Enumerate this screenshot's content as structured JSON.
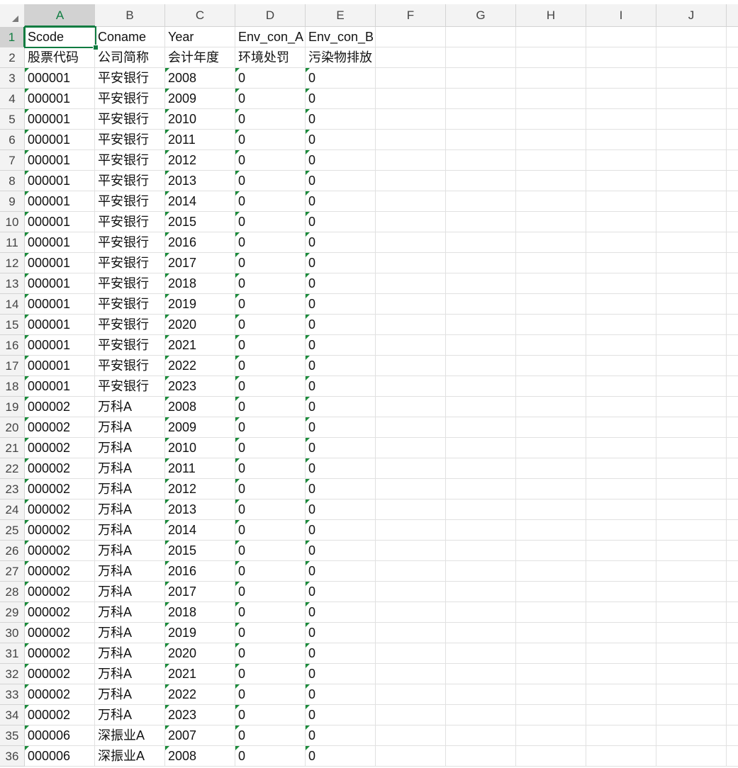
{
  "columns": [
    "A",
    "B",
    "C",
    "D",
    "E",
    "F",
    "G",
    "H",
    "I",
    "J"
  ],
  "selected_cell": "A1",
  "accent_color": "#107c41",
  "rows": [
    [
      "Scode",
      "Coname",
      "Year",
      "Env_con_A",
      "Env_con_B"
    ],
    [
      "股票代码",
      "公司简称",
      "会计年度",
      "环境处罚",
      "污染物排放"
    ],
    [
      "000001",
      "平安银行",
      "2008",
      "0",
      "0"
    ],
    [
      "000001",
      "平安银行",
      "2009",
      "0",
      "0"
    ],
    [
      "000001",
      "平安银行",
      "2010",
      "0",
      "0"
    ],
    [
      "000001",
      "平安银行",
      "2011",
      "0",
      "0"
    ],
    [
      "000001",
      "平安银行",
      "2012",
      "0",
      "0"
    ],
    [
      "000001",
      "平安银行",
      "2013",
      "0",
      "0"
    ],
    [
      "000001",
      "平安银行",
      "2014",
      "0",
      "0"
    ],
    [
      "000001",
      "平安银行",
      "2015",
      "0",
      "0"
    ],
    [
      "000001",
      "平安银行",
      "2016",
      "0",
      "0"
    ],
    [
      "000001",
      "平安银行",
      "2017",
      "0",
      "0"
    ],
    [
      "000001",
      "平安银行",
      "2018",
      "0",
      "0"
    ],
    [
      "000001",
      "平安银行",
      "2019",
      "0",
      "0"
    ],
    [
      "000001",
      "平安银行",
      "2020",
      "0",
      "0"
    ],
    [
      "000001",
      "平安银行",
      "2021",
      "0",
      "0"
    ],
    [
      "000001",
      "平安银行",
      "2022",
      "0",
      "0"
    ],
    [
      "000001",
      "平安银行",
      "2023",
      "0",
      "0"
    ],
    [
      "000002",
      "万科A",
      "2008",
      "0",
      "0"
    ],
    [
      "000002",
      "万科A",
      "2009",
      "0",
      "0"
    ],
    [
      "000002",
      "万科A",
      "2010",
      "0",
      "0"
    ],
    [
      "000002",
      "万科A",
      "2011",
      "0",
      "0"
    ],
    [
      "000002",
      "万科A",
      "2012",
      "0",
      "0"
    ],
    [
      "000002",
      "万科A",
      "2013",
      "0",
      "0"
    ],
    [
      "000002",
      "万科A",
      "2014",
      "0",
      "0"
    ],
    [
      "000002",
      "万科A",
      "2015",
      "0",
      "0"
    ],
    [
      "000002",
      "万科A",
      "2016",
      "0",
      "0"
    ],
    [
      "000002",
      "万科A",
      "2017",
      "0",
      "0"
    ],
    [
      "000002",
      "万科A",
      "2018",
      "0",
      "0"
    ],
    [
      "000002",
      "万科A",
      "2019",
      "0",
      "0"
    ],
    [
      "000002",
      "万科A",
      "2020",
      "0",
      "0"
    ],
    [
      "000002",
      "万科A",
      "2021",
      "0",
      "0"
    ],
    [
      "000002",
      "万科A",
      "2022",
      "0",
      "0"
    ],
    [
      "000002",
      "万科A",
      "2023",
      "0",
      "0"
    ],
    [
      "000006",
      "深振业A",
      "2007",
      "0",
      "0"
    ],
    [
      "000006",
      "深振业A",
      "2008",
      "0",
      "0"
    ]
  ]
}
